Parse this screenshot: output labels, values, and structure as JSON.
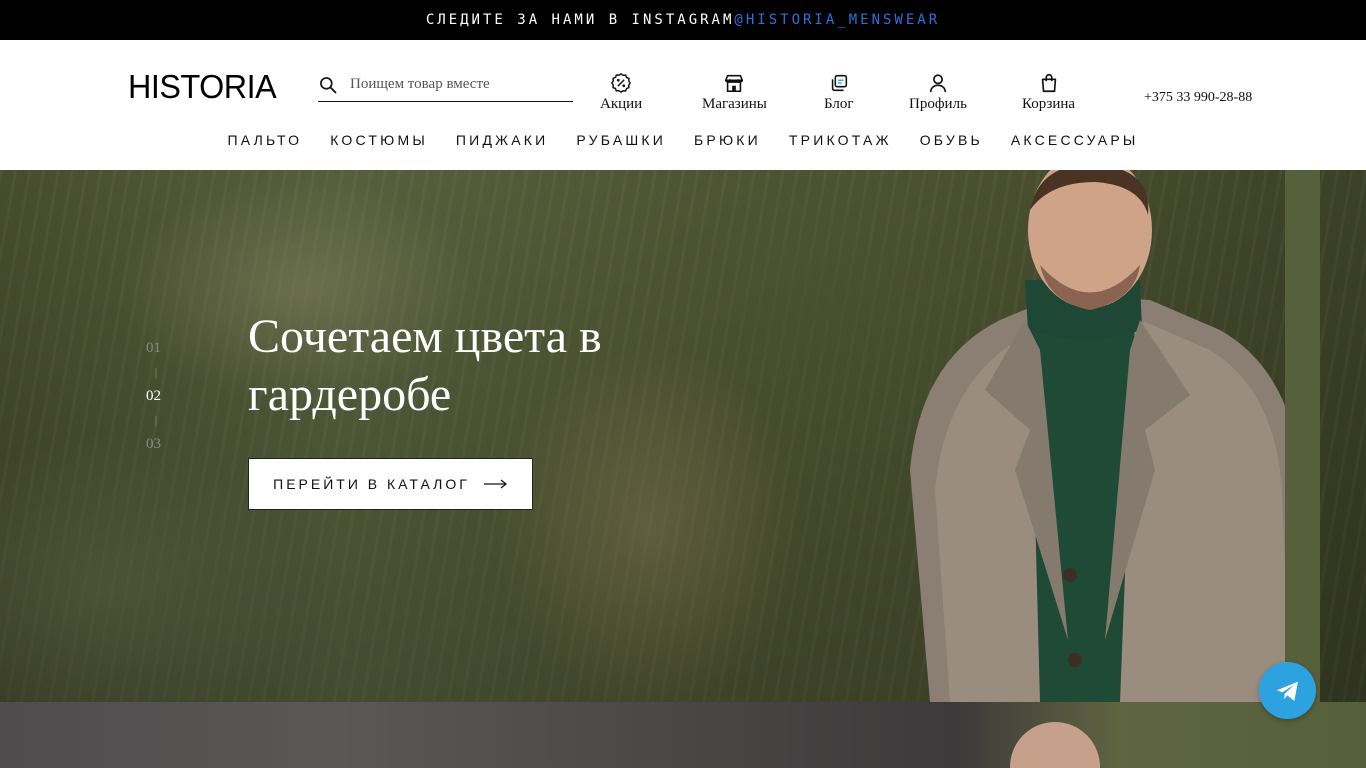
{
  "topbar": {
    "text": "СЛЕДИТЕ ЗА НАМИ В INSTAGRAM",
    "handle": "@HISTORIA_MENSWEAR"
  },
  "header": {
    "logo": "HISTORIA",
    "search_placeholder": "Поищем товар вместе",
    "icons": [
      {
        "label": "Акции",
        "icon": "percent-badge-icon"
      },
      {
        "label": "Магазины",
        "icon": "store-icon"
      },
      {
        "label": "Блог",
        "icon": "blog-icon"
      },
      {
        "label": "Профиль",
        "icon": "user-icon"
      },
      {
        "label": "Корзина",
        "icon": "bag-icon"
      }
    ],
    "phone": "+375 33 990-28-88"
  },
  "menu": [
    "ПАЛЬТО",
    "КОСТЮМЫ",
    "ПИДЖАКИ",
    "РУБАШКИ",
    "БРЮКИ",
    "ТРИКОТАЖ",
    "ОБУВЬ",
    "АКСЕССУАРЫ"
  ],
  "hero": {
    "title": "Сочетаем цвета в гардеробе",
    "button": "ПЕРЕЙТИ В КАТАЛОГ",
    "pager": [
      "01",
      "02",
      "03"
    ],
    "active_slide": "02"
  },
  "colors": {
    "topbar_bg": "#000000",
    "link": "#2f6fe0",
    "telegram": "#2ca3e0"
  }
}
